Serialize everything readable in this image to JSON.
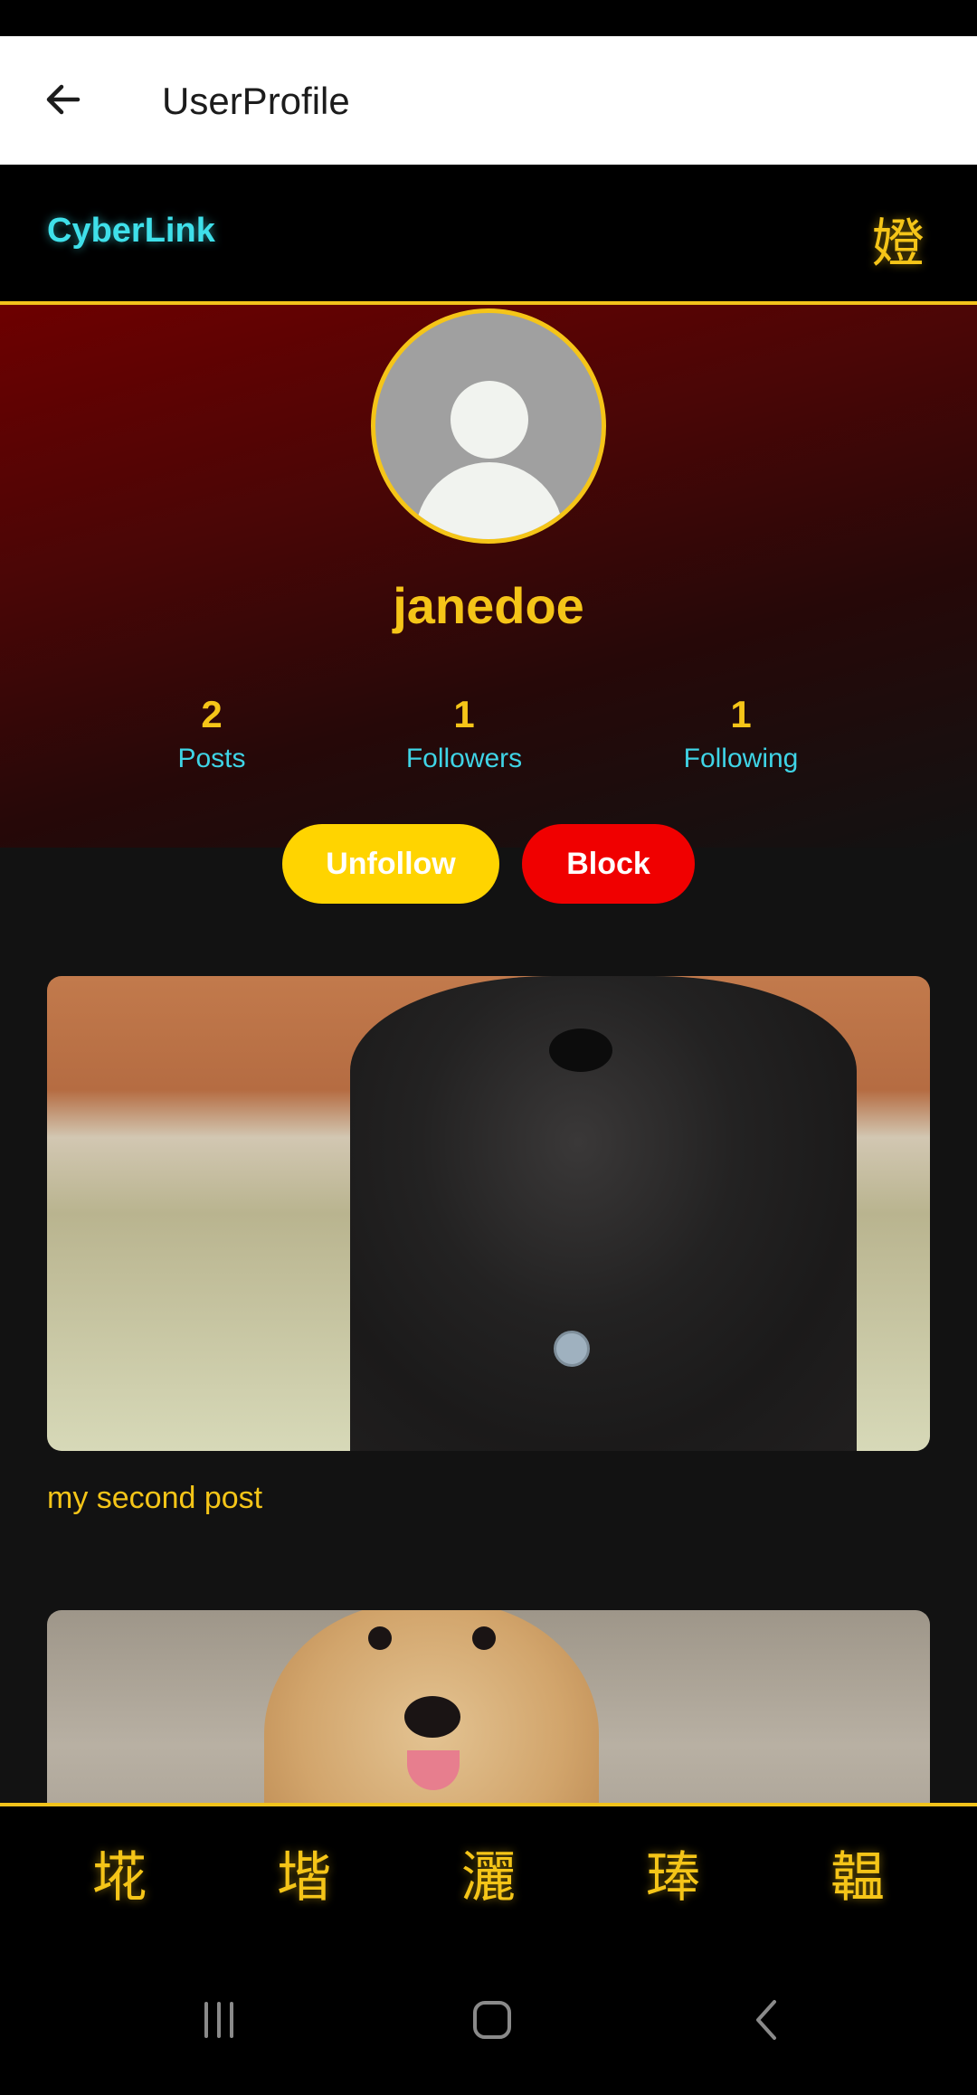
{
  "app_bar": {
    "title": "UserProfile",
    "back_icon": "arrow-left-icon"
  },
  "top_nav": {
    "brand": "CyberLink",
    "icon_glyph": "嬁"
  },
  "profile": {
    "username": "janedoe",
    "stats": [
      {
        "value": "2",
        "label": "Posts"
      },
      {
        "value": "1",
        "label": "Followers"
      },
      {
        "value": "1",
        "label": "Following"
      }
    ],
    "buttons": {
      "unfollow": "Unfollow",
      "block": "Block"
    }
  },
  "posts": [
    {
      "caption": "my second post",
      "image": "black-newfoundland-dog-photo"
    },
    {
      "caption": "",
      "image": "golden-retriever-puppy-photo"
    }
  ],
  "bottom_nav": {
    "items": [
      "埖",
      "堦",
      "灑",
      "琫",
      "韞"
    ]
  },
  "colors": {
    "accent_yellow": "#f5c518",
    "accent_cyan": "#3fd4e6",
    "block_red": "#f00000",
    "unfollow_yellow": "#ffd400",
    "hero_red": "#6d0000"
  },
  "system_nav": {
    "icons": [
      "recent-apps-icon",
      "home-icon",
      "back-icon"
    ]
  }
}
